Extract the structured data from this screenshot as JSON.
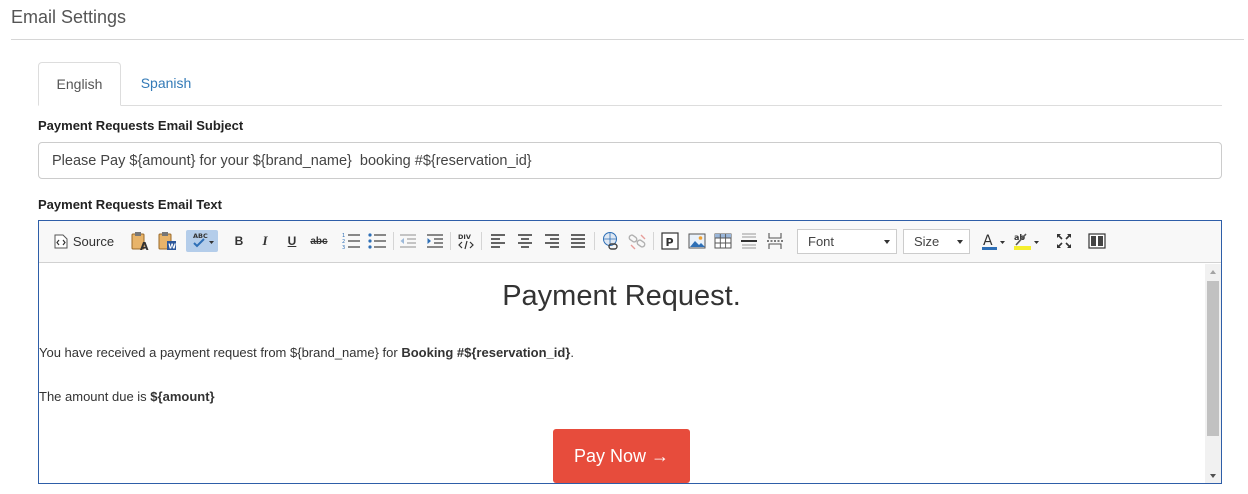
{
  "page": {
    "title": "Email Settings"
  },
  "tabs": [
    {
      "label": "English",
      "active": true
    },
    {
      "label": "Spanish",
      "active": false
    }
  ],
  "subject": {
    "label": "Payment Requests Email Subject",
    "value": "Please Pay ${amount} for your ${brand_name}  booking #${reservation_id}"
  },
  "body": {
    "label": "Payment Requests Email Text",
    "toolbar": {
      "source_label": "Source",
      "font_label": "Font",
      "size_label": "Size",
      "items": [
        "source",
        "paste-text",
        "paste-from-word",
        "spellcheck",
        "bold",
        "italic",
        "underline",
        "strikethrough",
        "numbered-list",
        "bulleted-list",
        "outdent",
        "indent",
        "create-div",
        "align-left",
        "align-center",
        "align-right",
        "justify",
        "link",
        "unlink",
        "placeholder",
        "image",
        "table",
        "horizontal-rule",
        "page-break",
        "font",
        "size",
        "text-color",
        "background-color",
        "maximize",
        "show-blocks"
      ]
    },
    "content": {
      "heading": "Payment Request.",
      "line1_prefix": "You have received a payment request from ${brand_name} for ",
      "line1_bold": "Booking #${reservation_id}",
      "line1_suffix": ".",
      "line2_prefix": "The amount due is ",
      "line2_bold": "${amount}",
      "button_label": "Pay Now →",
      "button_color": "#e74c3c"
    }
  },
  "colors": {
    "accent_link": "#337ab7",
    "editor_border": "#2e5ea8",
    "text_color_bar": "#2e6fb6",
    "highlight_bar": "#f5ef2e"
  }
}
